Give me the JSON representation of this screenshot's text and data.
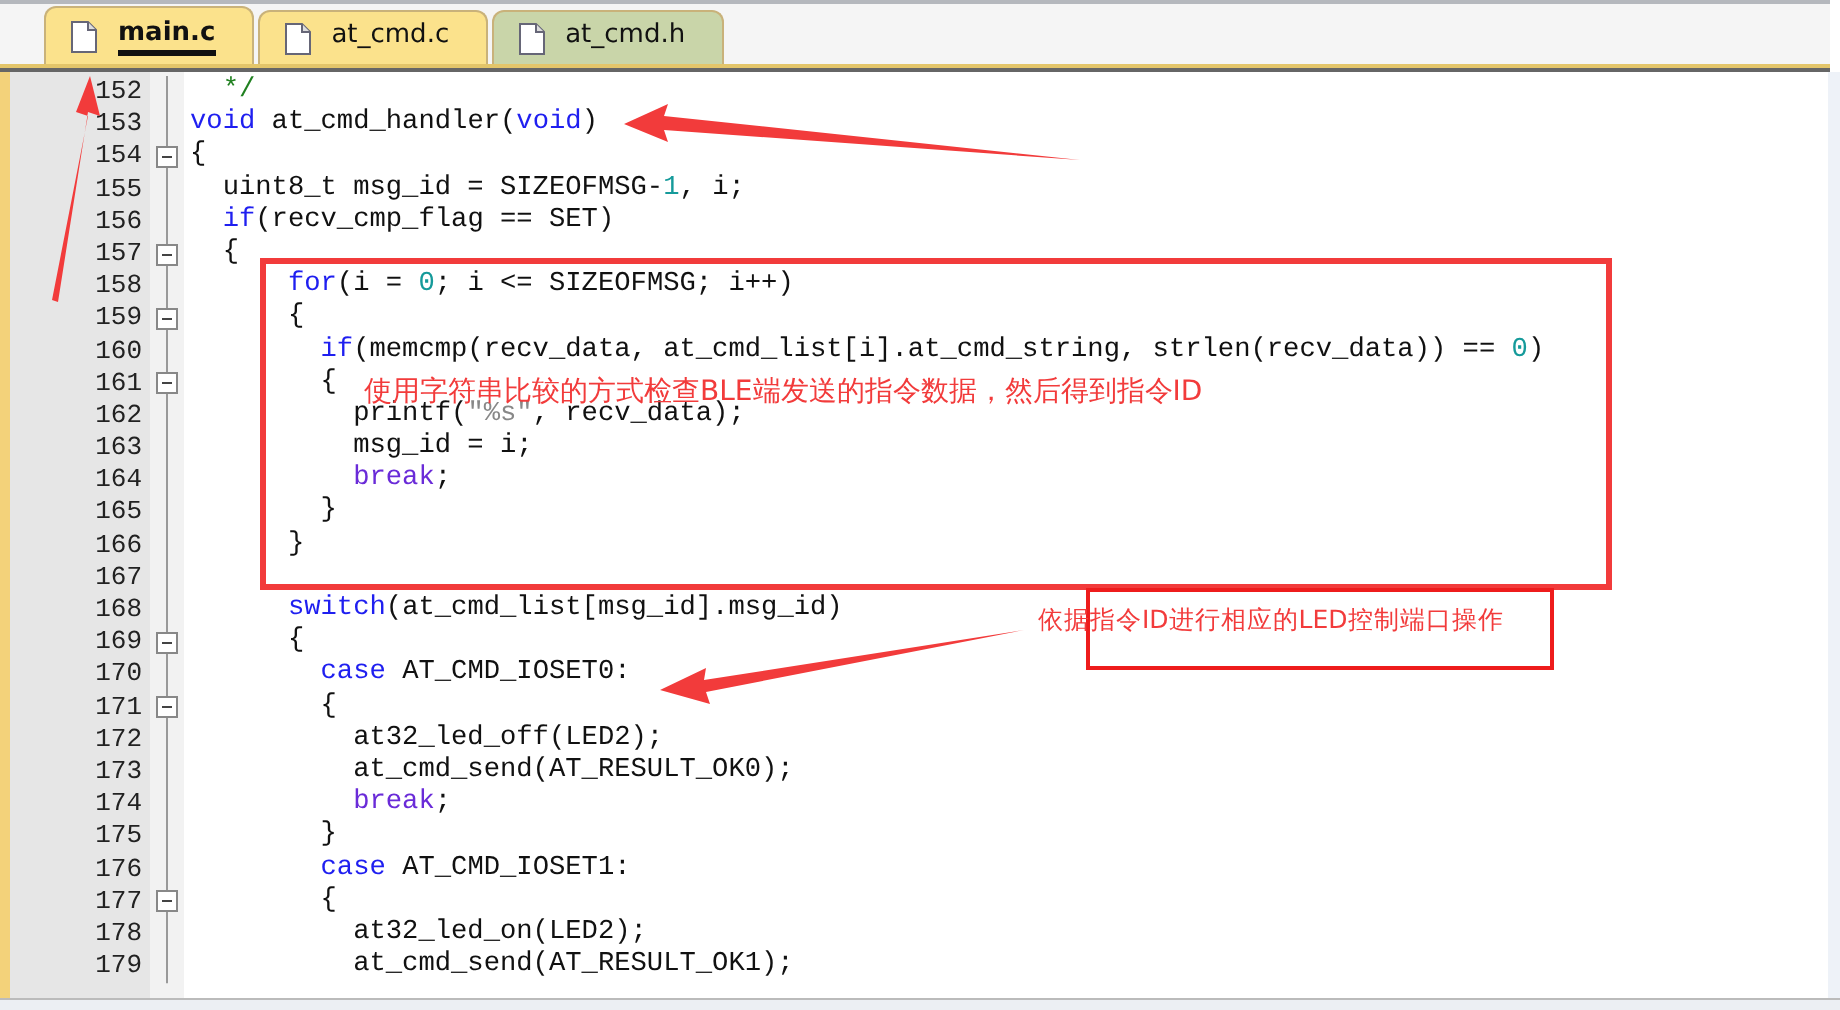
{
  "tabs": [
    {
      "label": "main.c",
      "selected": true,
      "color": "#fbe28c"
    },
    {
      "label": "at_cmd.c",
      "selected": false,
      "color": "#fbe28c"
    },
    {
      "label": "at_cmd.h",
      "selected": false,
      "color": "#c9d5a9"
    }
  ],
  "editor": {
    "lines": [
      {
        "number": "152",
        "segments": [
          {
            "kind": "comment",
            "text": "  */"
          }
        ]
      },
      {
        "number": "153",
        "segments": [
          {
            "kind": "keyword",
            "text": "void"
          },
          {
            "kind": "plain",
            "text": " at_cmd_handler("
          },
          {
            "kind": "keyword",
            "text": "void"
          },
          {
            "kind": "plain",
            "text": ")"
          }
        ]
      },
      {
        "number": "154",
        "expanded": true,
        "segments": [
          {
            "kind": "plain",
            "text": "{"
          }
        ]
      },
      {
        "number": "155",
        "segments": [
          {
            "kind": "plain",
            "text": "  uint8_t msg_id = SIZEOFMSG-"
          },
          {
            "kind": "number",
            "text": "1"
          },
          {
            "kind": "plain",
            "text": ", i;"
          }
        ]
      },
      {
        "number": "156",
        "segments": [
          {
            "kind": "keyword",
            "text": "  if"
          },
          {
            "kind": "plain",
            "text": "(recv_cmp_flag == SET)"
          }
        ]
      },
      {
        "number": "157",
        "expanded": true,
        "segments": [
          {
            "kind": "plain",
            "text": "  {"
          }
        ]
      },
      {
        "number": "158",
        "segments": [
          {
            "kind": "keyword",
            "text": "      for"
          },
          {
            "kind": "plain",
            "text": "(i = "
          },
          {
            "kind": "number",
            "text": "0"
          },
          {
            "kind": "plain",
            "text": "; i <= SIZEOFMSG; i++)"
          }
        ]
      },
      {
        "number": "159",
        "expanded": true,
        "segments": [
          {
            "kind": "plain",
            "text": "      {"
          }
        ]
      },
      {
        "number": "160",
        "segments": [
          {
            "kind": "keyword",
            "text": "        if"
          },
          {
            "kind": "plain",
            "text": "(memcmp(recv_data, at_cmd_list[i].at_cmd_string, strlen(recv_data)) == "
          },
          {
            "kind": "number",
            "text": "0"
          },
          {
            "kind": "plain",
            "text": ")"
          }
        ]
      },
      {
        "number": "161",
        "expanded": true,
        "segments": [
          {
            "kind": "plain",
            "text": "        {"
          }
        ]
      },
      {
        "number": "162",
        "segments": [
          {
            "kind": "plain",
            "text": "          printf("
          },
          {
            "kind": "string",
            "text": "\"%s\""
          },
          {
            "kind": "plain",
            "text": ", recv_data);"
          }
        ]
      },
      {
        "number": "163",
        "segments": [
          {
            "kind": "plain",
            "text": "          msg_id = i;"
          }
        ]
      },
      {
        "number": "164",
        "segments": [
          {
            "kind": "flow",
            "text": "          break"
          },
          {
            "kind": "plain",
            "text": ";"
          }
        ]
      },
      {
        "number": "165",
        "segments": [
          {
            "kind": "plain",
            "text": "        }"
          }
        ]
      },
      {
        "number": "166",
        "segments": [
          {
            "kind": "plain",
            "text": "      }"
          }
        ]
      },
      {
        "number": "167"
      },
      {
        "number": "168",
        "segments": [
          {
            "kind": "keyword",
            "text": "      switch"
          },
          {
            "kind": "plain",
            "text": "(at_cmd_list[msg_id].msg_id)"
          }
        ]
      },
      {
        "number": "169",
        "expanded": true,
        "segments": [
          {
            "kind": "plain",
            "text": "      {"
          }
        ]
      },
      {
        "number": "170",
        "segments": [
          {
            "kind": "keyword",
            "text": "        case"
          },
          {
            "kind": "plain",
            "text": " AT_CMD_IOSET0:"
          }
        ]
      },
      {
        "number": "171",
        "expanded": true,
        "segments": [
          {
            "kind": "plain",
            "text": "        {"
          }
        ]
      },
      {
        "number": "172",
        "segments": [
          {
            "kind": "plain",
            "text": "          at32_led_off(LED2);"
          }
        ]
      },
      {
        "number": "173",
        "segments": [
          {
            "kind": "plain",
            "text": "          at_cmd_send(AT_RESULT_OK0);"
          }
        ]
      },
      {
        "number": "174",
        "segments": [
          {
            "kind": "flow",
            "text": "          break"
          },
          {
            "kind": "plain",
            "text": ";"
          }
        ]
      },
      {
        "number": "175",
        "segments": [
          {
            "kind": "plain",
            "text": "        }"
          }
        ]
      },
      {
        "number": "176",
        "segments": [
          {
            "kind": "keyword",
            "text": "        case"
          },
          {
            "kind": "plain",
            "text": " AT_CMD_IOSET1:"
          }
        ]
      },
      {
        "number": "177",
        "expanded": true,
        "segments": [
          {
            "kind": "plain",
            "text": "        {"
          }
        ]
      },
      {
        "number": "178",
        "segments": [
          {
            "kind": "plain",
            "text": "          at32_led_on(LED2);"
          }
        ]
      },
      {
        "number": "179",
        "segments": [
          {
            "kind": "plain",
            "text": "          at_cmd_send(AT_RESULT_OK1);"
          }
        ]
      }
    ]
  },
  "annotations": [
    {
      "kind": "boxed",
      "text": "使用字符串比较的方式检查BLE端发送的指令数据，然后得到指令ID"
    },
    {
      "kind": "label",
      "text": "依据指令ID进行相应的LED控制端口操作"
    }
  ]
}
